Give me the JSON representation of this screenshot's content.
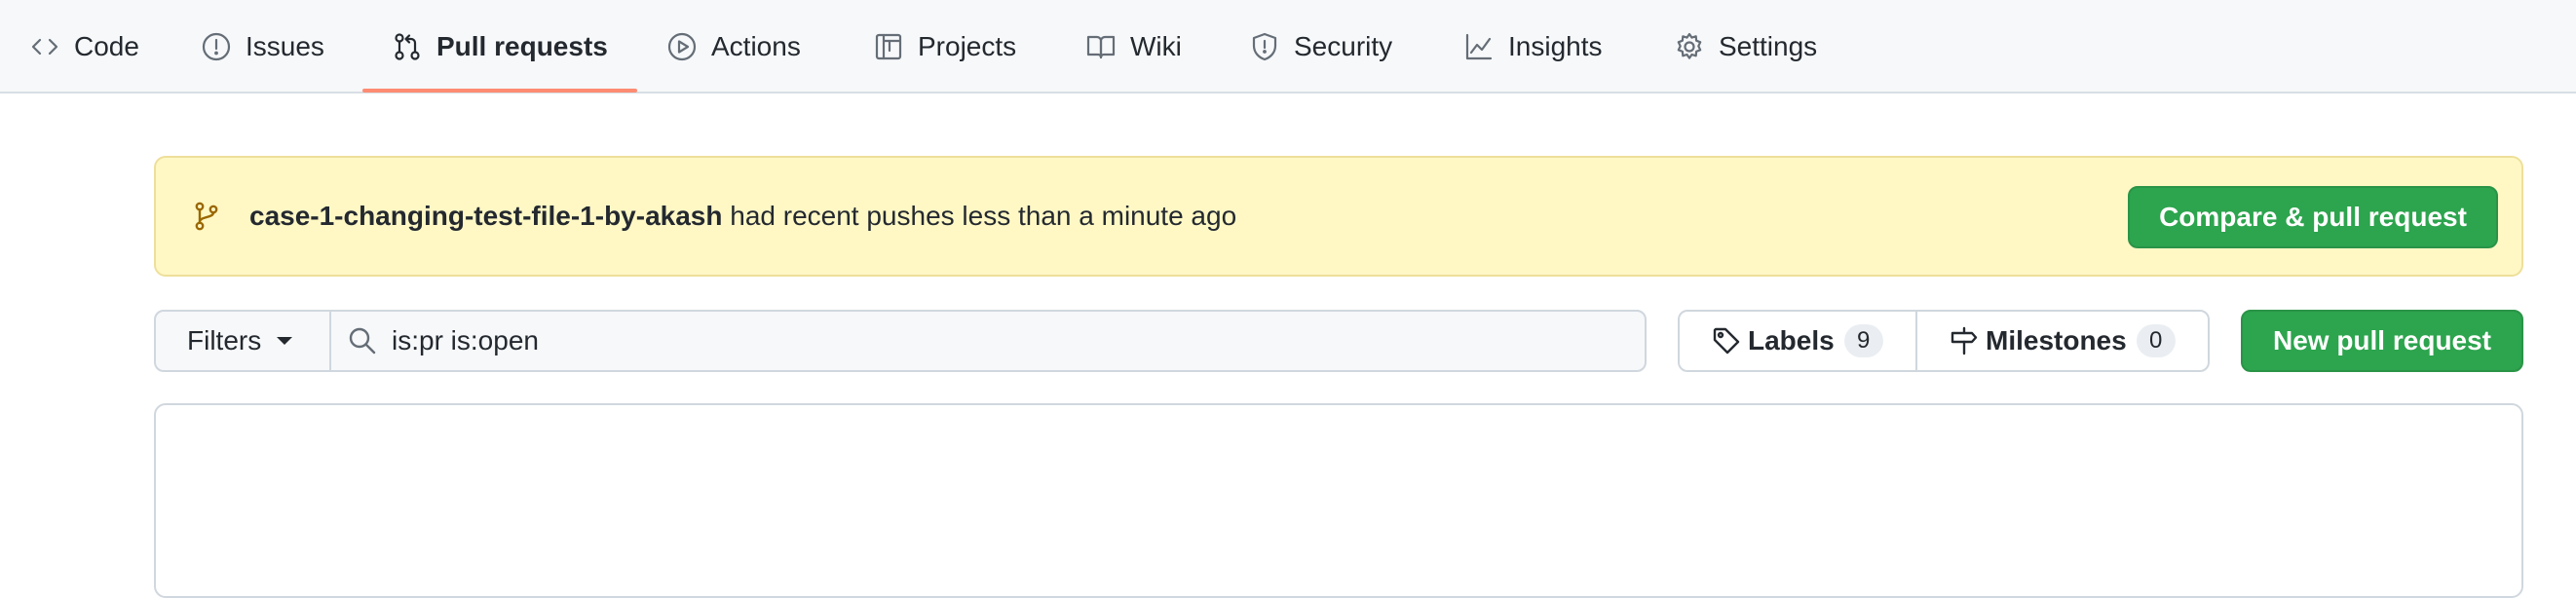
{
  "nav": {
    "tabs": [
      {
        "label": "Code",
        "icon": "code-icon"
      },
      {
        "label": "Issues",
        "icon": "issue-opened-icon"
      },
      {
        "label": "Pull requests",
        "icon": "git-pull-request-icon",
        "selected": true
      },
      {
        "label": "Actions",
        "icon": "play-icon"
      },
      {
        "label": "Projects",
        "icon": "table-icon"
      },
      {
        "label": "Wiki",
        "icon": "book-icon"
      },
      {
        "label": "Security",
        "icon": "shield-icon"
      },
      {
        "label": "Insights",
        "icon": "graph-icon"
      },
      {
        "label": "Settings",
        "icon": "gear-icon"
      }
    ]
  },
  "flash": {
    "branch": "case-1-changing-test-file-1-by-akash",
    "message": "had recent pushes less than a minute ago",
    "button": "Compare & pull request",
    "icon": "git-branch-icon"
  },
  "subnav": {
    "filters_label": "Filters",
    "search_value": "is:pr is:open",
    "labels_label": "Labels",
    "labels_count": "9",
    "milestones_label": "Milestones",
    "milestones_count": "0",
    "new_pr_button": "New pull request"
  },
  "colors": {
    "primary_button": "#2da44e",
    "flash_background": "#fff8c5",
    "selected_tab_underline": "#fd8c73"
  }
}
